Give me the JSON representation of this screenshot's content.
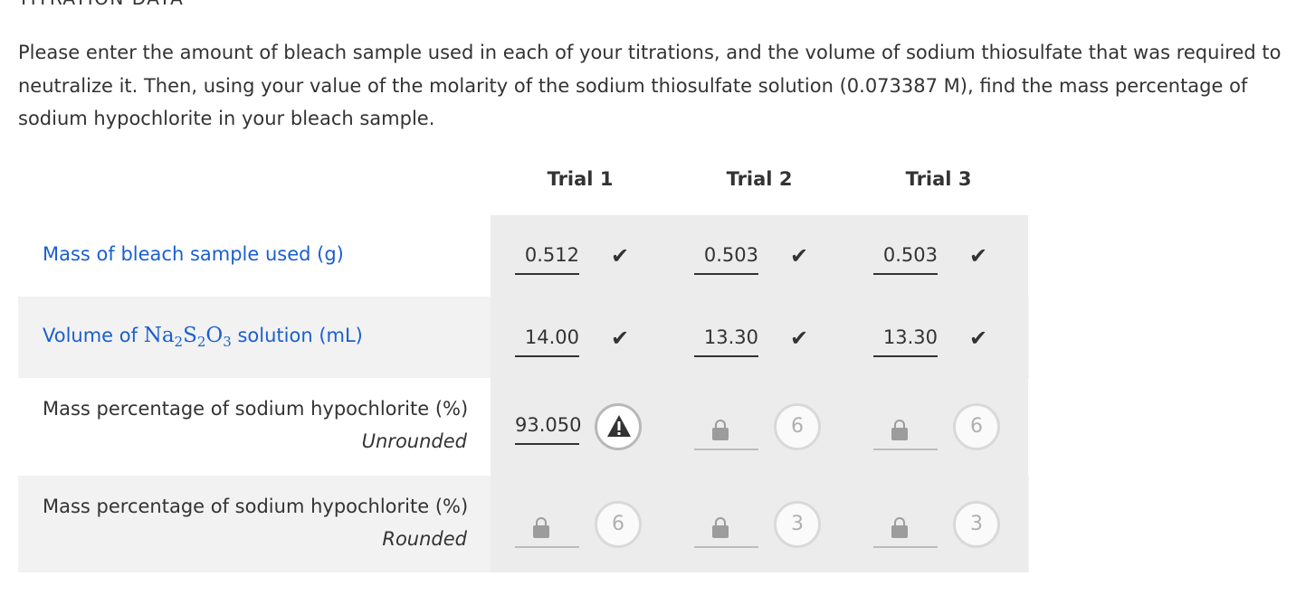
{
  "section_title": "TITRATION DATA",
  "intro_text": "Please enter the amount of bleach sample used in each of your titrations, and the volume of sodium thiosulfate that was required to neutralize it. Then, using your value of the molarity of the sodium thiosulfate solution (0.073387 M), find the mass percentage of sodium hypochlorite in your bleach sample.",
  "trials": [
    "Trial 1",
    "Trial 2",
    "Trial 3"
  ],
  "rows": {
    "mass": {
      "label": "Mass of bleach sample used (g)",
      "values": [
        "0.512",
        "0.503",
        "0.503"
      ],
      "status_icon": "check-icon",
      "check_glyph": "✔"
    },
    "volume": {
      "label_prefix": "Volume of ",
      "formula": {
        "na": "Na",
        "n1": "2",
        "s": "S",
        "n2": "2",
        "o": "O",
        "n3": "3"
      },
      "label_suffix": " solution (mL)",
      "values": [
        "14.00",
        "13.30",
        "13.30"
      ],
      "status_icon": "check-icon",
      "check_glyph": "✔"
    },
    "unrounded": {
      "label": "Mass percentage of sodium hypochlorite (%)",
      "note": "Unrounded",
      "trial1_value": "93.050",
      "trial1_icon": "warning-icon",
      "attempts": [
        "6",
        "6"
      ]
    },
    "rounded": {
      "label": "Mass percentage of sodium hypochlorite (%)",
      "note": "Rounded",
      "attempts": [
        "6",
        "3",
        "3"
      ]
    }
  },
  "colors": {
    "link": "#1a5fcf",
    "row_bg": "#f2f2f2",
    "cell_bg": "#ececec"
  }
}
